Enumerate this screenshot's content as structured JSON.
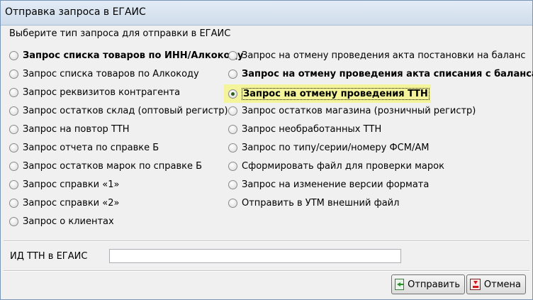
{
  "window": {
    "title": "Отправка запроса в ЕГАИС"
  },
  "heading": "Выберите тип запроса для отправки в ЕГАИС",
  "requests_left": [
    {
      "label": "Запрос списка товаров по ИНН/Алкокоду",
      "checked": false
    },
    {
      "label": "Запрос списка товаров по Алкокоду",
      "checked": false
    },
    {
      "label": "Запрос реквизитов контрагента",
      "checked": false
    },
    {
      "label": "Запрос остатков склад (оптовый регистр)",
      "checked": false
    },
    {
      "label": "Запрос на повтор ТТН",
      "checked": false
    },
    {
      "label": "Запрос отчета по справке Б",
      "checked": false
    },
    {
      "label": "Запрос остатков марок по справке Б",
      "checked": false
    },
    {
      "label": "Запрос справки «1»",
      "checked": false
    },
    {
      "label": "Запрос справки «2»",
      "checked": false
    },
    {
      "label": "Запрос о клиентах",
      "checked": false
    }
  ],
  "requests_right": [
    {
      "label": "Запрос на отмену проведения акта постановки на баланс",
      "checked": false
    },
    {
      "label": "Запрос на отмену проведения акта списания с баланса",
      "checked": false
    },
    {
      "label": "Запрос на отмену проведения ТТН",
      "checked": true
    },
    {
      "label": "Запрос остатков магазина (розничный регистр)",
      "checked": false
    },
    {
      "label": "Запрос необработанных ТТН",
      "checked": false
    },
    {
      "label": "Запрос по типу/серии/номеру ФСМ/АМ",
      "checked": false
    },
    {
      "label": "Сформировать файл для проверки марок",
      "checked": false
    },
    {
      "label": "Запрос на изменение версии формата",
      "checked": false
    },
    {
      "label": "Отправить в УТМ внешний файл",
      "checked": false
    }
  ],
  "id_field": {
    "label": "ИД ТТН в ЕГАИС",
    "value": ""
  },
  "buttons": {
    "send": "Отправить",
    "cancel": "Отмена"
  },
  "colors": {
    "highlight": "#f4f49a",
    "titlebar": "#cfdceb",
    "window_bg": "#f0f0f0"
  }
}
